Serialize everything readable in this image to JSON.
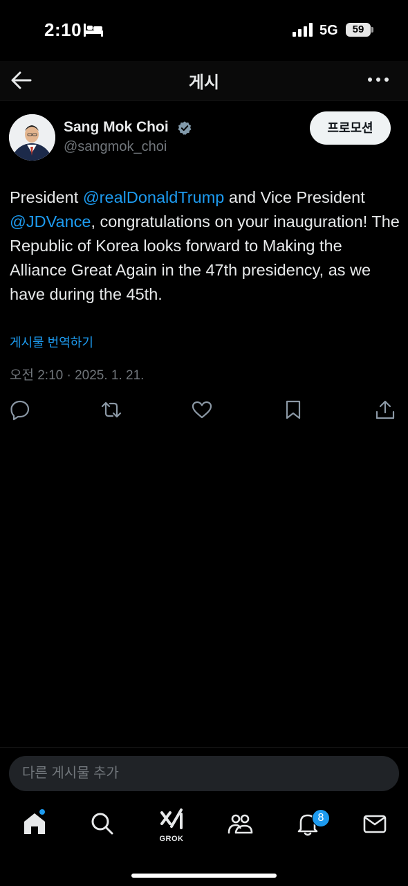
{
  "status_bar": {
    "time": "2:10",
    "network": "5G",
    "battery": "59"
  },
  "header": {
    "title": "게시"
  },
  "post": {
    "author": {
      "name": "Sang Mok Choi",
      "handle": "@sangmok_choi",
      "verified": true
    },
    "promote_label": "프로모션",
    "text_segments": [
      {
        "text": "President ",
        "mention": false
      },
      {
        "text": "@realDonaldTrump",
        "mention": true
      },
      {
        "text": " and Vice President ",
        "mention": false
      },
      {
        "text": "@JDVance",
        "mention": true
      },
      {
        "text": ", congratulations on your inauguration! The Republic of Korea looks forward to Making the Alliance Great Again in the 47th presidency, as we have during the 45th.",
        "mention": false
      }
    ],
    "translate_label": "게시물 번역하기",
    "timestamp": "오전 2:10 · 2025. 1. 21.",
    "actions": [
      "reply-icon",
      "repost-icon",
      "like-icon",
      "bookmark-icon",
      "share-icon"
    ]
  },
  "compose": {
    "placeholder": "다른 게시물 추가"
  },
  "tab_bar": {
    "grok_label": "GROK",
    "notification_count": "8",
    "tabs": [
      "home-icon",
      "search-icon",
      "grok-icon",
      "communities-icon",
      "notifications-icon",
      "messages-icon"
    ]
  },
  "colors": {
    "background": "#000000",
    "text": "#e7e9ea",
    "muted": "#71767b",
    "accent": "#1d9bf0"
  }
}
